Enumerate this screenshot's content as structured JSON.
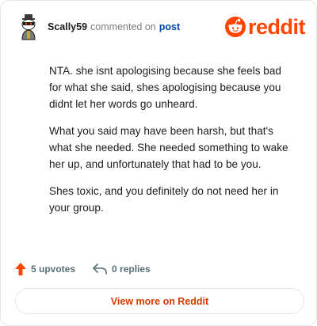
{
  "header": {
    "username": "Scally59",
    "action_text": "commented on",
    "post_link": "post",
    "brand_word": "reddit"
  },
  "comment": {
    "paragraphs": [
      "NTA. she isnt apologising because she feels bad for what she said, shes apologising because you didnt let her words go unheard.",
      "What you said may have been harsh, but that's what she needed. She needed something to wake her up, and unfortunately that had to be you.",
      "Shes toxic, and you definitely do not need her in your group."
    ]
  },
  "footer": {
    "upvotes": "5 upvotes",
    "replies": "0 replies"
  },
  "view_more": {
    "label": "View more on Reddit"
  },
  "icons": {
    "upvote": "upvote-arrow-icon",
    "reply": "reply-arrow-icon",
    "brand": "reddit-snoo-icon"
  },
  "colors": {
    "brand": "#ff4500",
    "link": "#0045ac",
    "muted": "#576f76"
  }
}
